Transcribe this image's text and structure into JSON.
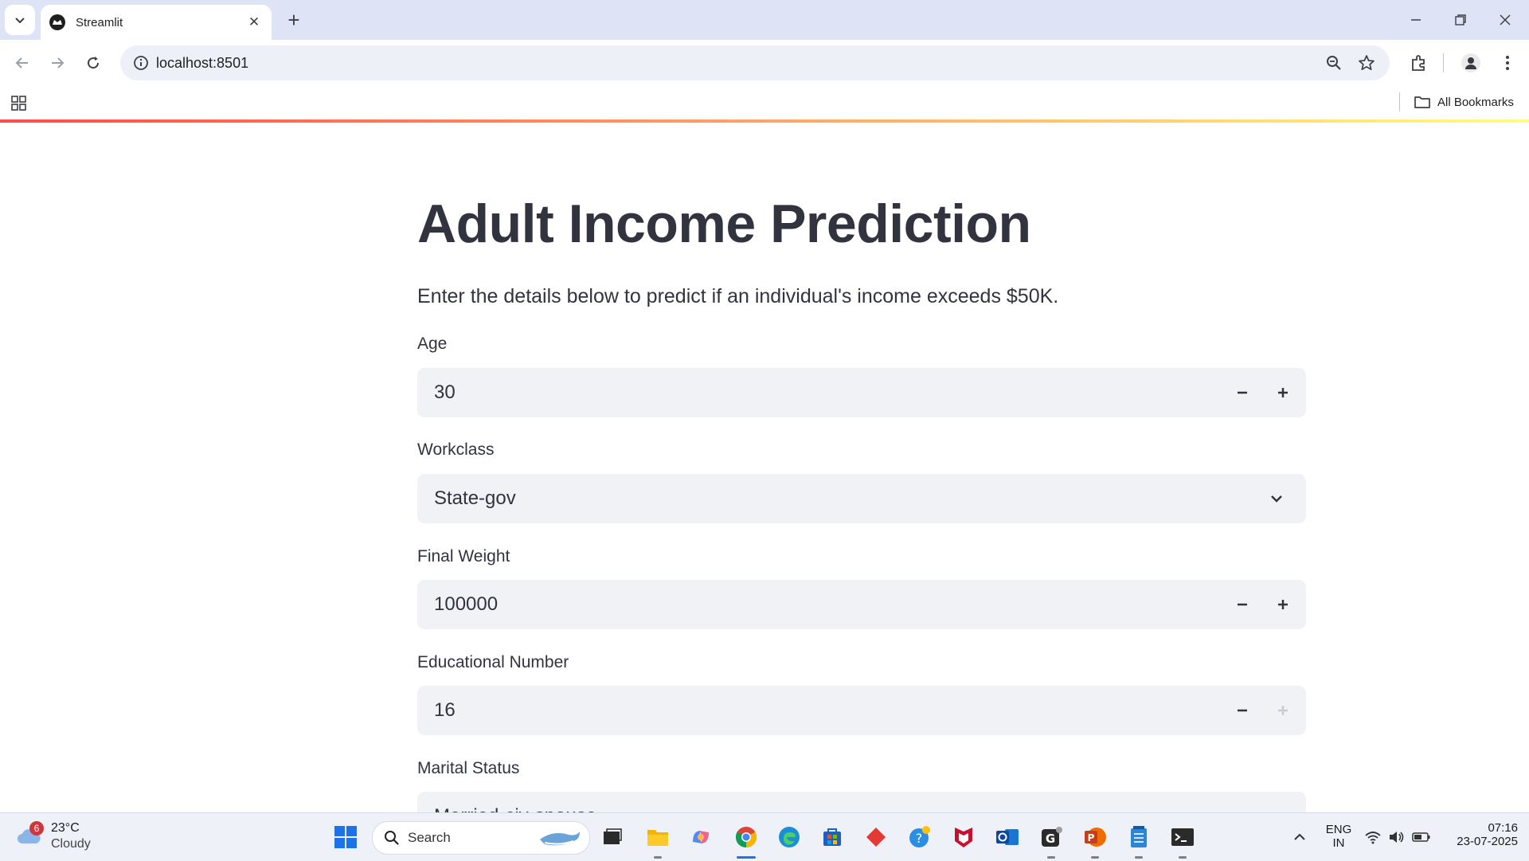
{
  "browser": {
    "tab_title": "Streamlit",
    "url": "localhost:8501",
    "bookmarks_label": "All Bookmarks"
  },
  "page": {
    "title": "Adult Income Prediction",
    "subtitle": "Enter the details below to predict if an individual's income exceeds $50K.",
    "fields": {
      "age": {
        "label": "Age",
        "value": "30"
      },
      "workclass": {
        "label": "Workclass",
        "value": "State-gov"
      },
      "final_weight": {
        "label": "Final Weight",
        "value": "100000"
      },
      "educational_number": {
        "label": "Educational Number",
        "value": "16"
      },
      "marital_status": {
        "label": "Marital Status",
        "value": "Married-civ-spouse"
      }
    },
    "stepper_minus": "−",
    "stepper_plus": "+"
  },
  "taskbar": {
    "weather_temp": "23°C",
    "weather_condition": "Cloudy",
    "weather_badge": "6",
    "search_label": "Search",
    "language_line1": "ENG",
    "language_line2": "IN",
    "time": "07:16",
    "date": "23-07-2025"
  },
  "colors": {
    "accent_red": "#ff4b4b",
    "input_bg": "#f0f2f6",
    "text": "#31333f"
  }
}
